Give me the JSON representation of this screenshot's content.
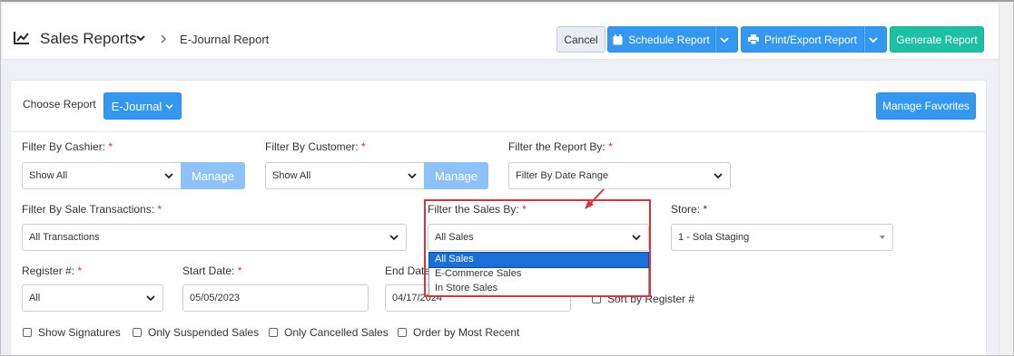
{
  "header": {
    "title": "Sales Reports",
    "breadcrumb": "E-Journal Report",
    "icons": {
      "chart": "line-chart-icon",
      "chevron": "chevron-down-icon",
      "separator": "chevron-right-icon"
    },
    "buttons": {
      "cancel": "Cancel",
      "schedule": "Schedule Report",
      "print_export": "Print/Export Report",
      "generate": "Generate Report"
    }
  },
  "choose_report": {
    "label": "Choose Report",
    "value": "E-Journal",
    "manage_favorites": "Manage Favorites"
  },
  "filters": {
    "cashier": {
      "label": "Filter By Cashier:",
      "value": "Show All",
      "manage": "Manage"
    },
    "customer": {
      "label": "Filter By Customer:",
      "value": "Show All",
      "manage": "Manage"
    },
    "report_by": {
      "label": "Filter the Report By:",
      "value": "Filter By Date Range"
    },
    "sale_transactions": {
      "label": "Filter By Sale Transactions:",
      "value": "All Transactions"
    },
    "sales_by": {
      "label": "Filter the Sales By:",
      "value": "All Sales",
      "options": [
        "All Sales",
        "E-Commerce Sales",
        "In Store Sales"
      ]
    },
    "store": {
      "label": "Store:",
      "value": "1 - Sola Staging"
    },
    "register": {
      "label": "Register #:",
      "value": "All"
    },
    "start_date": {
      "label": "Start Date:",
      "value": "05/05/2023"
    },
    "end_date": {
      "label": "End Date:",
      "value": "04/17/2024"
    },
    "sort_by_register": "Sort by Register #"
  },
  "checkboxes": [
    "Show Signatures",
    "Only Suspended Sales",
    "Only Cancelled Sales",
    "Order by Most Recent"
  ],
  "required_mark": "*",
  "colors": {
    "primary": "#3498f0",
    "generate": "#1ec0a4",
    "manage": "#8ec2f7",
    "required": "#e0303a",
    "highlight": "#e0303a",
    "selected_option": "#1a6fd6"
  }
}
